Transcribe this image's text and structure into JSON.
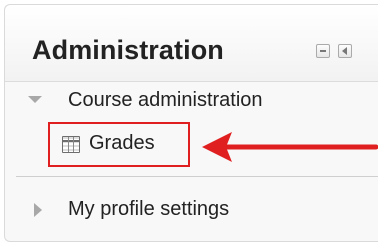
{
  "block": {
    "title": "Administration",
    "controls": {
      "minimize_icon": "minus-icon",
      "dock_icon": "dock-left-icon"
    }
  },
  "tree": {
    "course_admin": {
      "label": "Course administration",
      "state": "expanded"
    },
    "grades": {
      "label": "Grades",
      "icon": "grades-table-icon",
      "highlighted": true
    },
    "profile": {
      "label": "My profile settings",
      "state": "collapsed"
    }
  },
  "annotation": {
    "box_color": "#e02020",
    "arrow_color": "#e02020"
  }
}
